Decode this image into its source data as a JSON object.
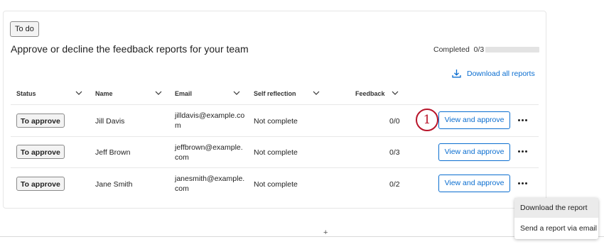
{
  "card": {
    "badge": "To do",
    "headline": "Approve or decline the feedback reports for your team",
    "completed_label": "Completed",
    "completed_value": "0/3",
    "progress_fraction": 0,
    "download_all": "Download all reports"
  },
  "table": {
    "columns": [
      "Status",
      "Name",
      "Email",
      "Self reflection",
      "Feedback"
    ],
    "rows": [
      {
        "status": "To approve",
        "name": "Jill Davis",
        "email": "jilldavis@example.com",
        "self_reflection": "Not complete",
        "feedback": "0/0",
        "action": "View and approve"
      },
      {
        "status": "To approve",
        "name": "Jeff Brown",
        "email": "jeffbrown@example.com",
        "self_reflection": "Not complete",
        "feedback": "0/3",
        "action": "View and approve"
      },
      {
        "status": "To approve",
        "name": "Jane Smith",
        "email": "janesmith@example.com",
        "self_reflection": "Not complete",
        "feedback": "0/2",
        "action": "View and approve"
      }
    ]
  },
  "step_marker": "1",
  "context_menu": {
    "items": [
      "Download the report",
      "Send a report via email"
    ]
  },
  "icons": {
    "download": "download-icon",
    "chevron": "chevron-down-icon",
    "more": "more-horizontal-icon",
    "plus": "plus-icon"
  },
  "colors": {
    "accent": "#0b6ed0",
    "marker": "#b8142a",
    "menu_hover": "#ebebeb"
  }
}
